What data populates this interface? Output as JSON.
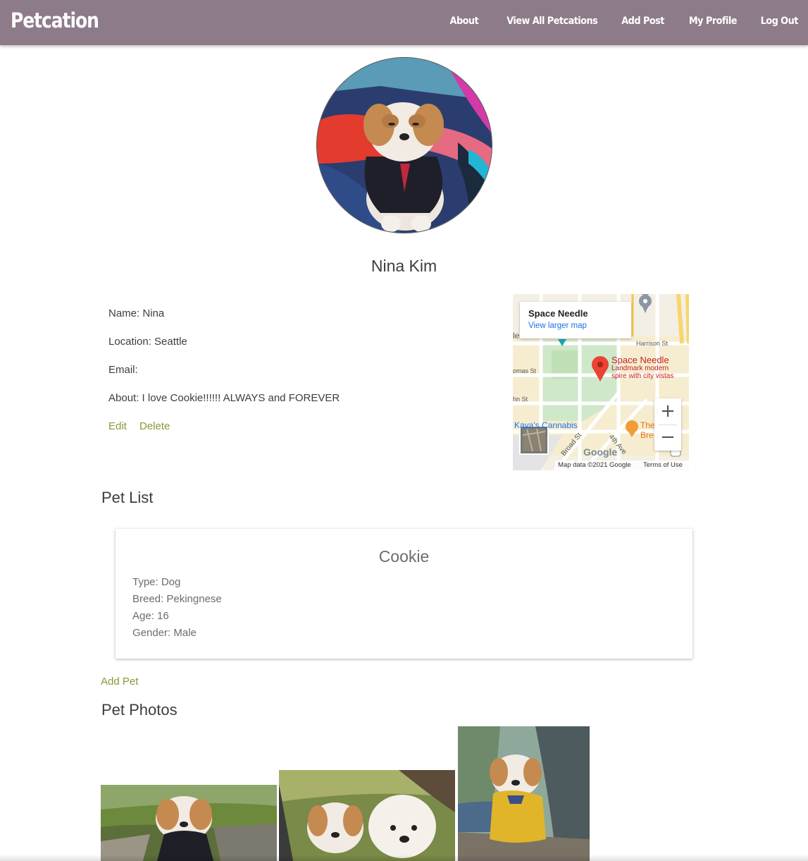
{
  "nav": {
    "brand": "Petcation",
    "links": [
      "About",
      "View All Petcations",
      "Add Post",
      "My Profile",
      "Log Out"
    ]
  },
  "profile": {
    "display_name": "Nina Kim",
    "name_line": "Name: Nina",
    "location_line": "Location: Seattle",
    "email_line": "Email:",
    "about_line": "About: I love Cookie!!!!!! ALWAYS and FOREVER",
    "edit_label": "Edit",
    "delete_label": "Delete"
  },
  "map": {
    "place_title": "Space Needle",
    "view_larger": "View larger map",
    "pin_title": "Space Needle",
    "pin_desc1": "Landmark modern",
    "pin_desc2": "spire with city vistas",
    "label_harrison": "Harrison St",
    "label_thomas": "omas St",
    "label_john": "hn St",
    "label_center": "le Center",
    "label_cannabis": "Kaya's Cannabis",
    "label_broad": "Broad St",
    "label_4th": "4th Ave",
    "label_the": "The",
    "label_bre": "Bre",
    "google": "Google",
    "map_data": "Map data ©2021 Google",
    "terms": "Terms of Use",
    "zoom_in": "+",
    "zoom_out": "−"
  },
  "pets": {
    "section_title": "Pet List",
    "items": [
      {
        "name": "Cookie",
        "type": "Type: Dog",
        "breed": "Breed: Pekingnese",
        "age": "Age: 16",
        "gender": "Gender: Male"
      }
    ],
    "add_label": "Add Pet"
  },
  "photos": {
    "section_title": "Pet Photos"
  },
  "colors": {
    "navbar": "#8e7b89",
    "link_green": "#87983a",
    "text": "#3d3d3d"
  }
}
